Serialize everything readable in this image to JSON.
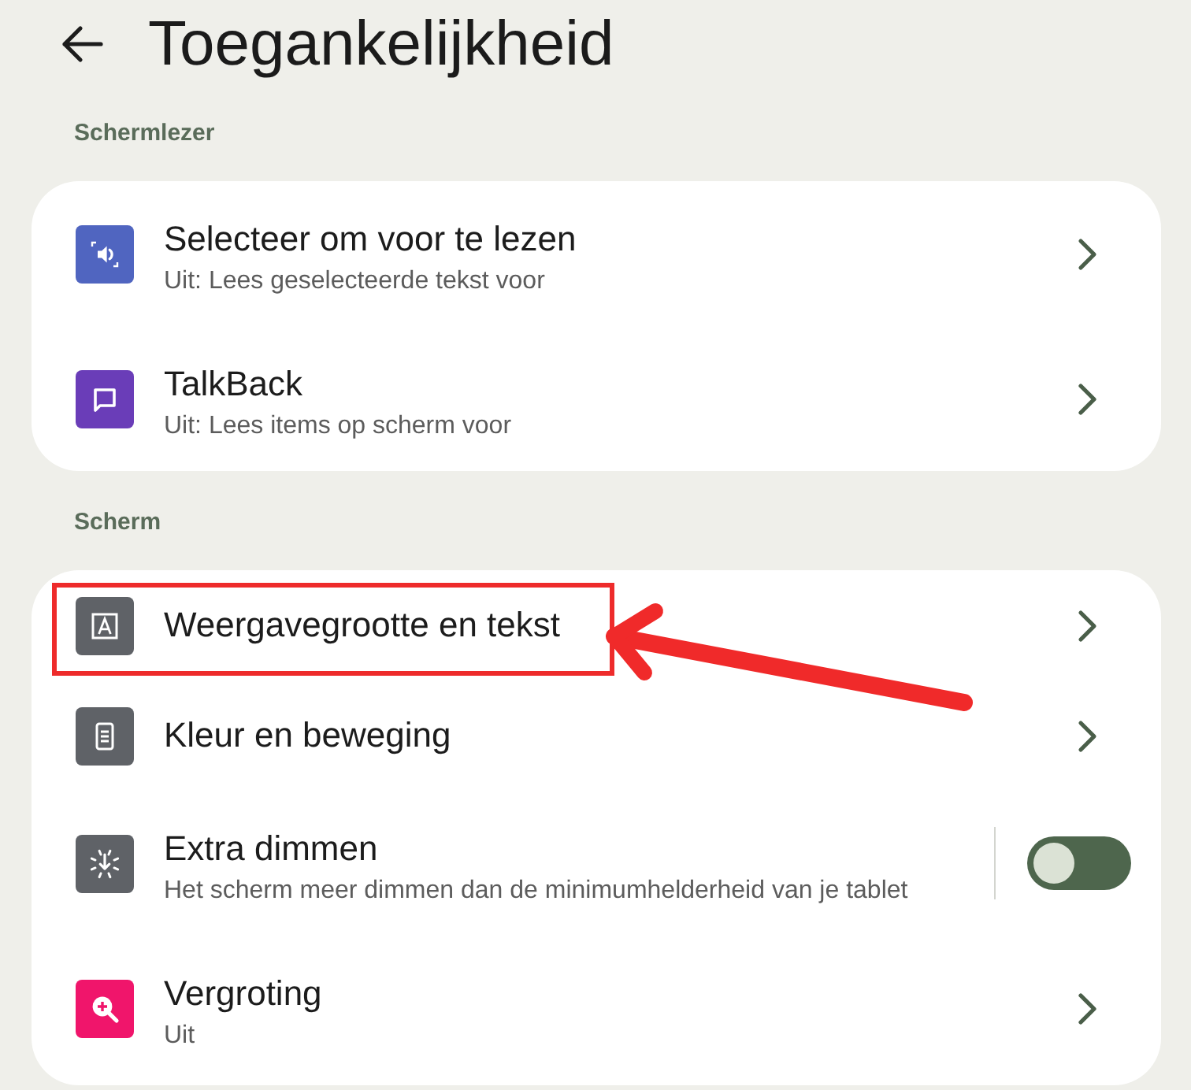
{
  "header": {
    "title": "Toegankelijkheid"
  },
  "sections": [
    {
      "label": "Schermlezer",
      "items": [
        {
          "kind": "link",
          "title": "Selecteer om voor te lezen",
          "subtitle": "Uit: Lees geselecteerde tekst voor",
          "color": "#5065c0",
          "highlighted": false
        },
        {
          "kind": "link",
          "title": "TalkBack",
          "subtitle": "Uit: Lees items op scherm voor",
          "color": "#6a3db8",
          "highlighted": false
        }
      ]
    },
    {
      "label": "Scherm",
      "items": [
        {
          "kind": "link",
          "title": "Weergavegrootte en tekst",
          "color": "#5f6267",
          "highlighted": true
        },
        {
          "kind": "link",
          "title": "Kleur en beweging",
          "color": "#5f6267",
          "highlighted": false
        },
        {
          "kind": "toggle",
          "title": "Extra dimmen",
          "subtitle": "Het scherm meer dimmen dan de minimumhelderheid van je tablet",
          "color": "#5f6267",
          "on": false,
          "highlighted": false
        },
        {
          "kind": "link",
          "title": "Vergroting",
          "subtitle": "Uit",
          "color": "#f0156b",
          "highlighted": false
        }
      ]
    }
  ]
}
